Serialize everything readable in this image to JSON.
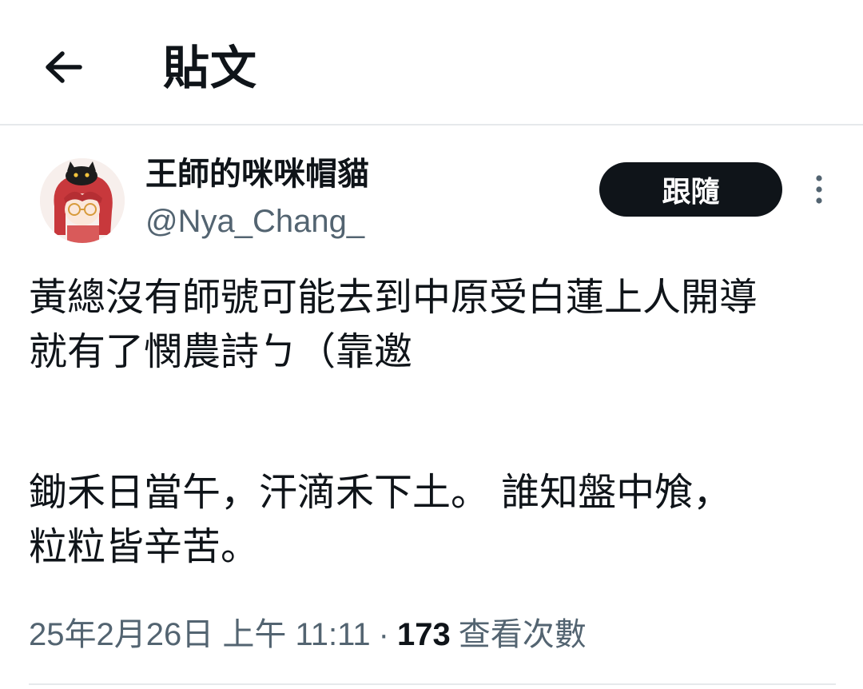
{
  "header": {
    "back_icon": "arrow-left-icon",
    "title": "貼文"
  },
  "author": {
    "name": "王師的咪咪帽貓",
    "handle": "@Nya_Chang_",
    "follow_label": "跟隨",
    "more_icon": "more-vertical-icon"
  },
  "post": {
    "lines": [
      "黃總沒有師號可能去到中原受白蓮上人開導",
      "就有了憫農詩ㄅ（靠邀",
      "",
      "鋤禾日當午，汗滴禾下土。 誰知盤中飧，",
      "粒粒皆辛苦。"
    ]
  },
  "meta": {
    "timestamp": "25年2月26日 上午 11:11",
    "separator": "·",
    "views_count": "173",
    "views_label": "查看次數"
  },
  "colors": {
    "text": "#0f1419",
    "secondary": "#536471",
    "divider": "#e6e9eb",
    "button_bg": "#0f1419"
  }
}
